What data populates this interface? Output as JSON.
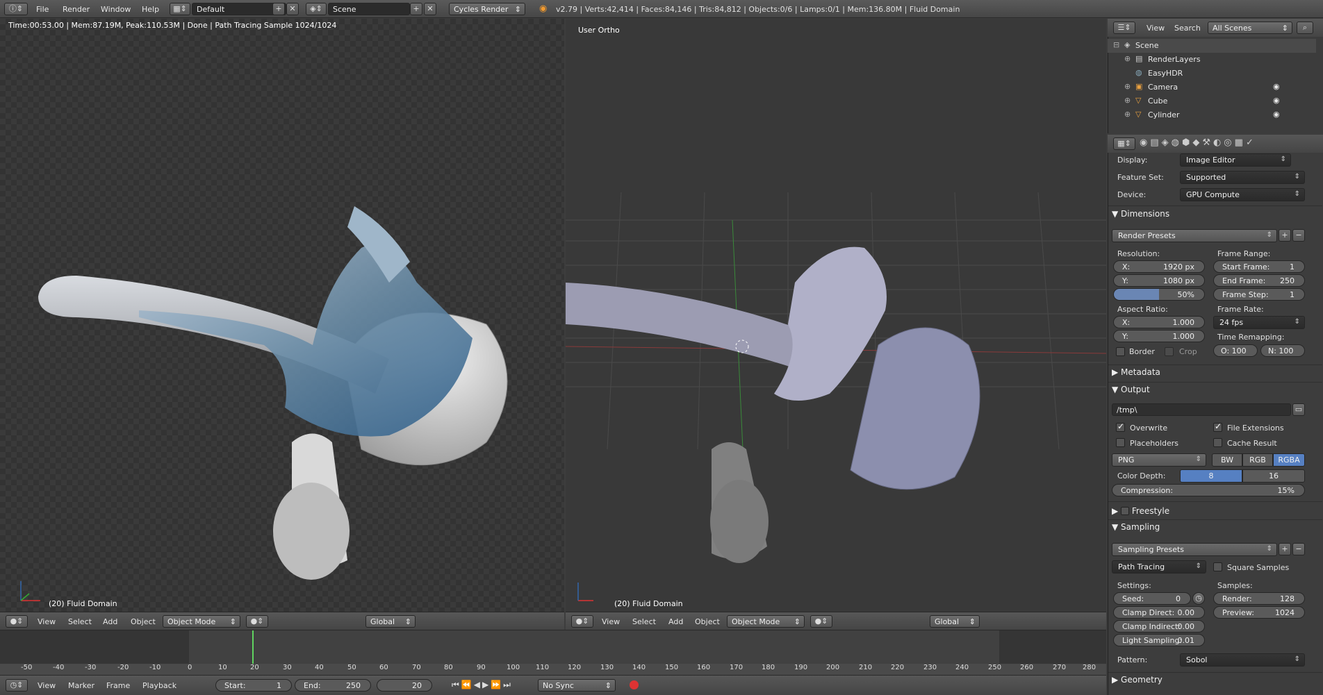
{
  "topbar": {
    "menus": [
      "File",
      "Render",
      "Window",
      "Help"
    ],
    "layout": "Default",
    "scene": "Scene",
    "engine": "Cycles Render",
    "stats": "v2.79 | Verts:42,414 | Faces:84,146 | Tris:84,812 | Objects:0/6 | Lamps:0/1 | Mem:136.80M | Fluid Domain"
  },
  "left_viewport": {
    "render_info": "Time:00:53.00 | Mem:87.19M, Peak:110.53M | Done | Path Tracing Sample 1024/1024",
    "object_label": "(20) Fluid Domain",
    "header": {
      "menus": [
        "View",
        "Select",
        "Add",
        "Object"
      ],
      "mode": "Object Mode",
      "orientation": "Global"
    }
  },
  "right_viewport": {
    "view_label": "User Ortho",
    "object_label": "(20) Fluid Domain",
    "header": {
      "menus": [
        "View",
        "Select",
        "Add",
        "Object"
      ],
      "mode": "Object Mode",
      "orientation": "Global"
    }
  },
  "timeline": {
    "ticks": [
      "-50",
      "-40",
      "-30",
      "-20",
      "-10",
      "0",
      "10",
      "20",
      "30",
      "40",
      "50",
      "60",
      "70",
      "80",
      "90",
      "100",
      "110",
      "120",
      "130",
      "140",
      "150",
      "160",
      "170",
      "180",
      "190",
      "200",
      "210",
      "220",
      "230",
      "240",
      "250",
      "260",
      "270",
      "280"
    ],
    "menus": [
      "View",
      "Marker",
      "Frame",
      "Playback"
    ],
    "start_label": "Start:",
    "start": "1",
    "end_label": "End:",
    "end": "250",
    "current": "20",
    "sync": "No Sync"
  },
  "outliner": {
    "menus": [
      "View",
      "Search"
    ],
    "filter": "All Scenes",
    "items": [
      {
        "label": "Scene",
        "indent": 0
      },
      {
        "label": "RenderLayers",
        "indent": 1
      },
      {
        "label": "EasyHDR",
        "indent": 1
      },
      {
        "label": "Camera",
        "indent": 1
      },
      {
        "label": "Cube",
        "indent": 1
      },
      {
        "label": "Cylinder",
        "indent": 1
      }
    ]
  },
  "properties": {
    "display_label": "Display:",
    "display": "Image Editor",
    "feature_set_label": "Feature Set:",
    "feature_set": "Supported",
    "device_label": "Device:",
    "device": "GPU Compute",
    "dimensions": {
      "title": "Dimensions",
      "presets": "Render Presets",
      "resolution_label": "Resolution:",
      "res_x_label": "X:",
      "res_x": "1920 px",
      "res_y_label": "Y:",
      "res_y": "1080 px",
      "res_pct": "50%",
      "frame_range_label": "Frame Range:",
      "start_frame_label": "Start Frame:",
      "start_frame": "1",
      "end_frame_label": "End Frame:",
      "end_frame": "250",
      "frame_step_label": "Frame Step:",
      "frame_step": "1",
      "aspect_label": "Aspect Ratio:",
      "aspect_x_label": "X:",
      "aspect_x": "1.000",
      "aspect_y_label": "Y:",
      "aspect_y": "1.000",
      "frame_rate_label": "Frame Rate:",
      "frame_rate": "24 fps",
      "time_remap_label": "Time Remapping:",
      "remap_old": "O: 100",
      "remap_new": "N: 100",
      "border": "Border",
      "crop": "Crop"
    },
    "metadata": {
      "title": "Metadata"
    },
    "output": {
      "title": "Output",
      "path": "/tmp\\",
      "overwrite": "Overwrite",
      "file_ext": "File Extensions",
      "placeholders": "Placeholders",
      "cache": "Cache Result",
      "format": "PNG",
      "bw": "BW",
      "rgb": "RGB",
      "rgba": "RGBA",
      "depth_label": "Color Depth:",
      "depth_8": "8",
      "depth_16": "16",
      "compression_label": "Compression:",
      "compression": "15%"
    },
    "freestyle": {
      "title": "Freestyle"
    },
    "sampling": {
      "title": "Sampling",
      "presets": "Sampling Presets",
      "integrator": "Path Tracing",
      "square": "Square Samples",
      "settings_label": "Settings:",
      "seed_label": "Seed:",
      "seed": "0",
      "clamp_direct_label": "Clamp Direct:",
      "clamp_direct": "0.00",
      "clamp_indirect_label": "Clamp Indirect:",
      "clamp_indirect": "0.00",
      "light_sampling_label": "Light Sampling:",
      "light_sampling": "0.01",
      "samples_label": "Samples:",
      "render_label": "Render:",
      "render": "128",
      "preview_label": "Preview:",
      "preview": "1024",
      "pattern_label": "Pattern:",
      "pattern": "Sobol"
    },
    "geometry": {
      "title": "Geometry"
    }
  },
  "colors": {
    "accent": "#5680c2",
    "timeline_cursor": "#5fd35f"
  }
}
